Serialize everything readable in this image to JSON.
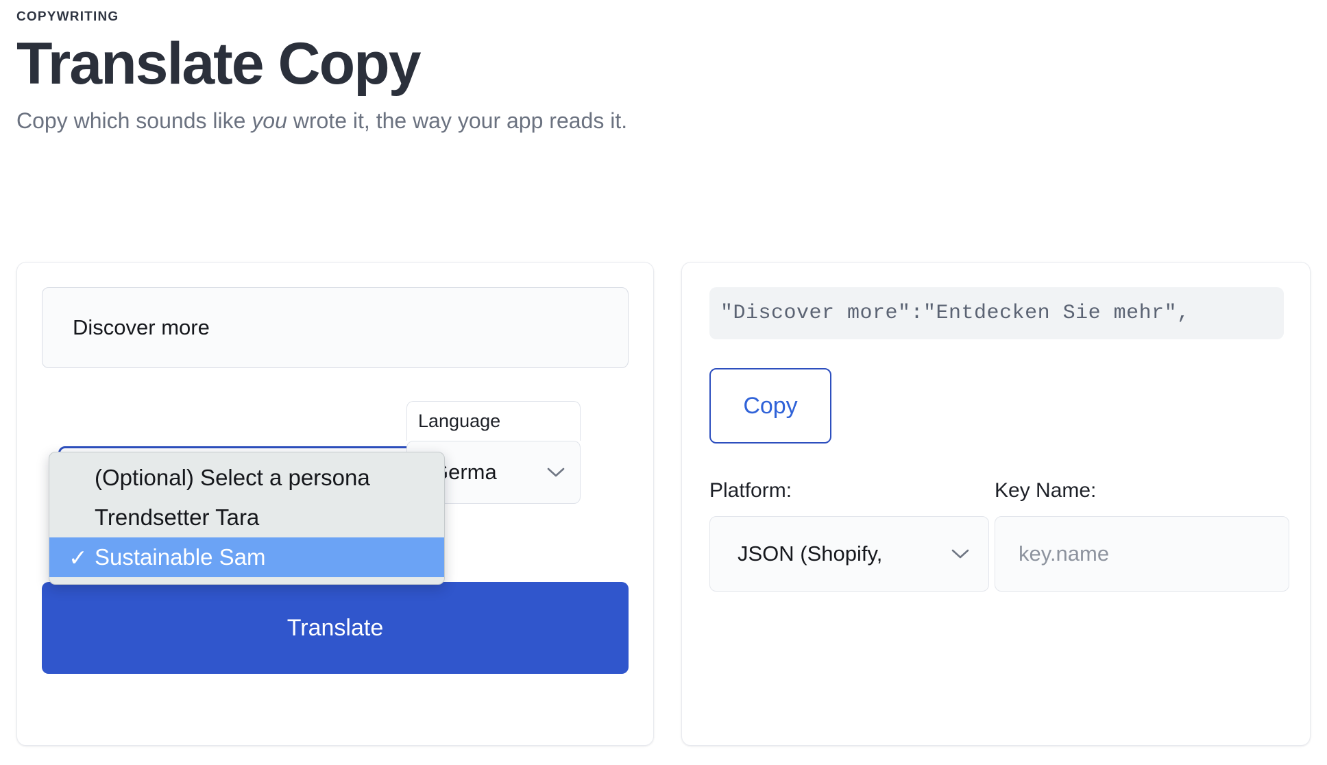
{
  "header": {
    "eyebrow": "COPYWRITING",
    "title": "Translate Copy",
    "subtitle_before": "Copy which sounds like ",
    "subtitle_emphasis": "you",
    "subtitle_after": " wrote it, the way your app reads it."
  },
  "left_panel": {
    "source_text": "Discover more",
    "persona": {
      "selected_value": "Sustainable Sam",
      "dropdown_open": true,
      "options": [
        {
          "label": "(Optional) Select a persona",
          "selected": false,
          "check": ""
        },
        {
          "label": "Trendsetter Tara",
          "selected": false,
          "check": ""
        },
        {
          "label": "Sustainable Sam",
          "selected": true,
          "check": "✓"
        }
      ]
    },
    "language": {
      "label": "Language",
      "selected_value": "Germa",
      "caret_icon": "chevron-down-icon"
    },
    "translate_button": "Translate"
  },
  "right_panel": {
    "output_text": "\"Discover more\":\"Entdecken Sie mehr\",",
    "copy_button": "Copy",
    "platform": {
      "label": "Platform:",
      "selected_value": "JSON (Shopify,",
      "caret_icon": "chevron-down-icon"
    },
    "key_name": {
      "label": "Key Name:",
      "placeholder": "key.name",
      "value": ""
    }
  },
  "colors": {
    "primary_blue": "#3056cc",
    "link_blue": "#2f62d8",
    "highlight_blue": "#6ba3f5",
    "title_dark": "#2b303b",
    "muted_text": "#6b7280"
  }
}
